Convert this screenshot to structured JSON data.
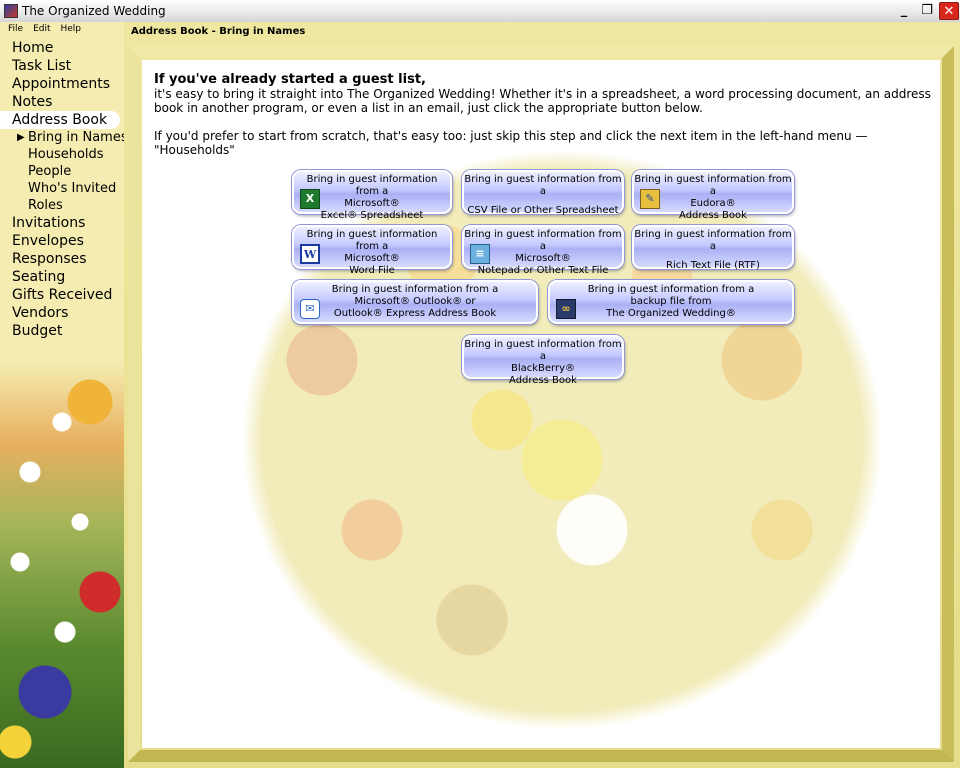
{
  "window": {
    "title": "The Organized Wedding",
    "minimize_glyph": "_",
    "maximize_glyph": "❐",
    "close_glyph": "✕"
  },
  "menu": [
    "File",
    "Edit",
    "Help"
  ],
  "nav": {
    "items": [
      "Home",
      "Task List",
      "Appointments",
      "Notes",
      "Address Book"
    ],
    "sub_items": [
      "Bring in Names",
      "Households",
      "People",
      "Who's Invited",
      "Roles"
    ],
    "items_after": [
      "Invitations",
      "Envelopes",
      "Responses",
      "Seating",
      "Gifts Received",
      "Vendors",
      "Budget"
    ],
    "active_sub_arrow": "▶"
  },
  "breadcrumb": "Address Book - Bring in Names",
  "intro": {
    "heading": "If you've already started a guest list,",
    "body": "it's easy to bring it straight into The Organized Wedding! Whether it's in a spreadsheet, a word processing document, an address book in another program, or even a list in an email, just click the appropriate button below.",
    "scratch": "If you'd prefer to start from scratch, that's easy too: just skip this step and click the next item in the left-hand menu — \"Households\""
  },
  "buttons": [
    {
      "prefix": "Bring in guest information from a",
      "lines": [
        "Microsoft®",
        "Excel® Spreadsheet"
      ],
      "icon": "excel-icon",
      "icon_glyph": "X"
    },
    {
      "prefix": "Bring in guest information from a",
      "lines": [
        "CSV File or Other Spreadsheet"
      ],
      "icon": "",
      "icon_glyph": ""
    },
    {
      "prefix": "Bring in guest information from a",
      "lines": [
        "Eudora®",
        "Address Book"
      ],
      "icon": "eudora-icon",
      "icon_glyph": "✎"
    },
    {
      "prefix": "Bring in guest information from a",
      "lines": [
        "Microsoft®",
        "Word File"
      ],
      "icon": "word-icon",
      "icon_glyph": "W"
    },
    {
      "prefix": "Bring in guest information from a",
      "lines": [
        "Microsoft®",
        "Notepad or Other Text File"
      ],
      "icon": "notepad-icon",
      "icon_glyph": "≡"
    },
    {
      "prefix": "Bring in guest information from a",
      "lines": [
        "Rich Text File (RTF)"
      ],
      "icon": "",
      "icon_glyph": ""
    },
    {
      "prefix": "Bring in guest information from a",
      "lines": [
        "Microsoft® Outlook® or",
        "Outlook® Express Address Book"
      ],
      "icon": "outlook-icon",
      "icon_glyph": "✉"
    },
    {
      "prefix": "Bring in guest information from a",
      "lines": [
        "backup file from",
        "The Organized Wedding®"
      ],
      "icon": "backup-icon",
      "icon_glyph": "∞"
    },
    {
      "prefix": "Bring in guest information from a",
      "lines": [
        "BlackBerry®",
        "Address Book"
      ],
      "icon": "",
      "icon_glyph": ""
    }
  ]
}
